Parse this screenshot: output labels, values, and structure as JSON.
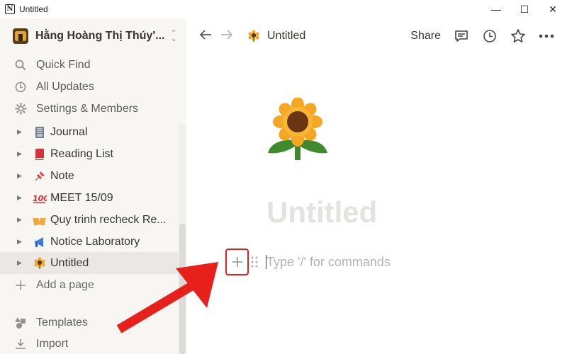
{
  "window": {
    "title": "Untitled",
    "controls": {
      "minimize": "—",
      "maximize": "☐",
      "close": "✕"
    }
  },
  "workspace": {
    "name": "Hằng Hoàng Thị Thúy'...",
    "switcher_icon": "chevron-up-down-icon"
  },
  "sidebar": {
    "nav": [
      {
        "label": "Quick Find",
        "icon": "search-icon"
      },
      {
        "label": "All Updates",
        "icon": "clock-icon"
      },
      {
        "label": "Settings & Members",
        "icon": "gear-icon"
      }
    ],
    "pages": [
      {
        "label": "Journal",
        "emoji": "notebook"
      },
      {
        "label": "Reading List",
        "emoji": "closed-book"
      },
      {
        "label": "Note",
        "emoji": "pushpin"
      },
      {
        "label": "MEET 15/09",
        "emoji": "hundred-points"
      },
      {
        "label": "Quy trinh recheck Re...",
        "emoji": "beer-mugs"
      },
      {
        "label": "Notice Laboratory",
        "emoji": "megaphone"
      },
      {
        "label": "Untitled",
        "emoji": "sunflower",
        "active": true
      }
    ],
    "add_page": "Add a page",
    "bottom": [
      {
        "label": "Templates",
        "icon": "shapes-icon"
      },
      {
        "label": "Import",
        "icon": "download-icon"
      }
    ]
  },
  "topbar": {
    "breadcrumb": "Untitled",
    "share": "Share",
    "icons": [
      "comment-icon",
      "history-clock-icon",
      "star-icon",
      "more-icon"
    ]
  },
  "page": {
    "icon": "sunflower",
    "title": "Untitled",
    "block_placeholder": "Type '/' for commands"
  },
  "colors": {
    "sidebar_bg": "#f7f6f3",
    "active_row": "#e9e8e5",
    "highlight_red": "#e0201c",
    "title_placeholder": "#e3e2df"
  }
}
